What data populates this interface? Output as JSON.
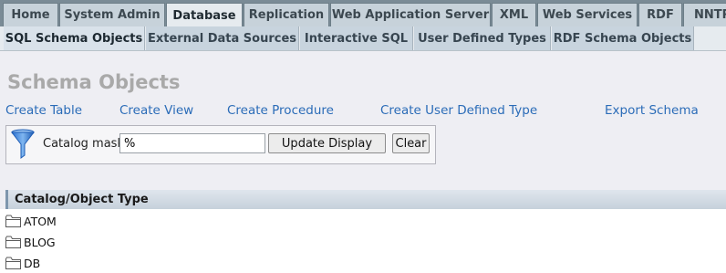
{
  "top_tabs": [
    {
      "label": "Home",
      "active": false
    },
    {
      "label": "System Admin",
      "active": false
    },
    {
      "label": "Database",
      "active": true
    },
    {
      "label": "Replication",
      "active": false
    },
    {
      "label": "Web Application Server",
      "active": false
    },
    {
      "label": "XML",
      "active": false
    },
    {
      "label": "Web Services",
      "active": false
    },
    {
      "label": "RDF",
      "active": false
    },
    {
      "label": "NNTP",
      "active": false
    }
  ],
  "sub_tabs": [
    {
      "label": "SQL Schema Objects",
      "active": true
    },
    {
      "label": "External Data Sources",
      "active": false
    },
    {
      "label": "Interactive SQL",
      "active": false
    },
    {
      "label": "User Defined Types",
      "active": false
    },
    {
      "label": "RDF Schema Objects",
      "active": false
    }
  ],
  "page_title": "Schema Objects",
  "actions": {
    "create_table": "Create Table",
    "create_view": "Create View",
    "create_procedure": "Create Procedure",
    "create_udt": "Create User Defined Type",
    "export_schema": "Export Schema"
  },
  "filter": {
    "label": "Catalog mask",
    "value": "%",
    "update_button": "Update Display",
    "clear_button": "Clear"
  },
  "tree": {
    "header": "Catalog/Object Type",
    "items": [
      "ATOM",
      "BLOG",
      "DB"
    ]
  },
  "colors": {
    "link": "#2b6cb8",
    "title": "#a9a9a9",
    "tab_bar": "#7a8b96"
  },
  "icons": {
    "filter": "funnel-icon",
    "folder": "folder-icon"
  }
}
